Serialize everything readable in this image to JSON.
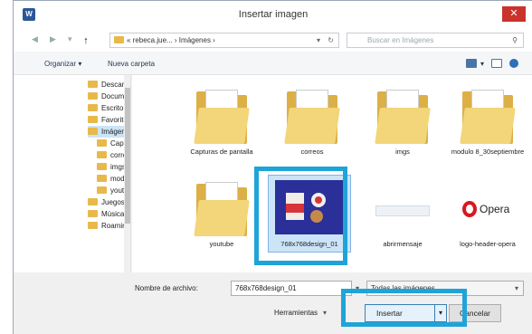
{
  "window": {
    "title": "Insertar imagen",
    "close_label": "✕"
  },
  "nav": {
    "back": "◀",
    "forward": "▶",
    "recent": "▾",
    "up": "🠕",
    "address": "« rebeca.jue... › Imágenes ›",
    "address_dropdown": "▾",
    "refresh": "↻",
    "search_placeholder": "Buscar en Imágenes",
    "search_icon": "⚲"
  },
  "toolbar": {
    "organize": "Organizar ▾",
    "new_folder": "Nueva carpeta",
    "view_dropdown": "▾"
  },
  "sidebar": {
    "items": [
      {
        "label": "Descarga",
        "selected": false
      },
      {
        "label": "Documer",
        "selected": false
      },
      {
        "label": "Escritorio",
        "selected": false
      },
      {
        "label": "Favoritos",
        "selected": false
      },
      {
        "label": "Imágenes",
        "selected": true
      },
      {
        "label": "Captur",
        "selected": false
      },
      {
        "label": "correos",
        "selected": false
      },
      {
        "label": "imgs",
        "selected": false
      },
      {
        "label": "modulo",
        "selected": false
      },
      {
        "label": "youtub",
        "selected": false
      },
      {
        "label": "Juegos gu",
        "selected": false
      },
      {
        "label": "Música",
        "selected": false
      },
      {
        "label": "Roaming",
        "selected": false
      }
    ]
  },
  "files": [
    {
      "name": "Capturas de pantalla",
      "kind": "folder"
    },
    {
      "name": "correos",
      "kind": "folder"
    },
    {
      "name": "imgs",
      "kind": "folder"
    },
    {
      "name": "modulo 8_30septiembre",
      "kind": "folder"
    },
    {
      "name": "youtube",
      "kind": "folder"
    },
    {
      "name": "768x768design_01",
      "kind": "image",
      "selected": true
    },
    {
      "name": "abrirmensaje",
      "kind": "image"
    },
    {
      "name": "logo-header-opera",
      "kind": "image",
      "logo_text": "Opera"
    }
  ],
  "bottom": {
    "filename_label": "Nombre de archivo:",
    "filename_value": "768x768design_01",
    "filetype_value": "Todas las imágenes",
    "tools_label": "Herramientas",
    "insert_label": "Insertar",
    "cancel_label": "Cancelar"
  },
  "colors": {
    "highlight": "#1fa4d8",
    "folder": "#e8b94a",
    "close": "#c9332b"
  }
}
